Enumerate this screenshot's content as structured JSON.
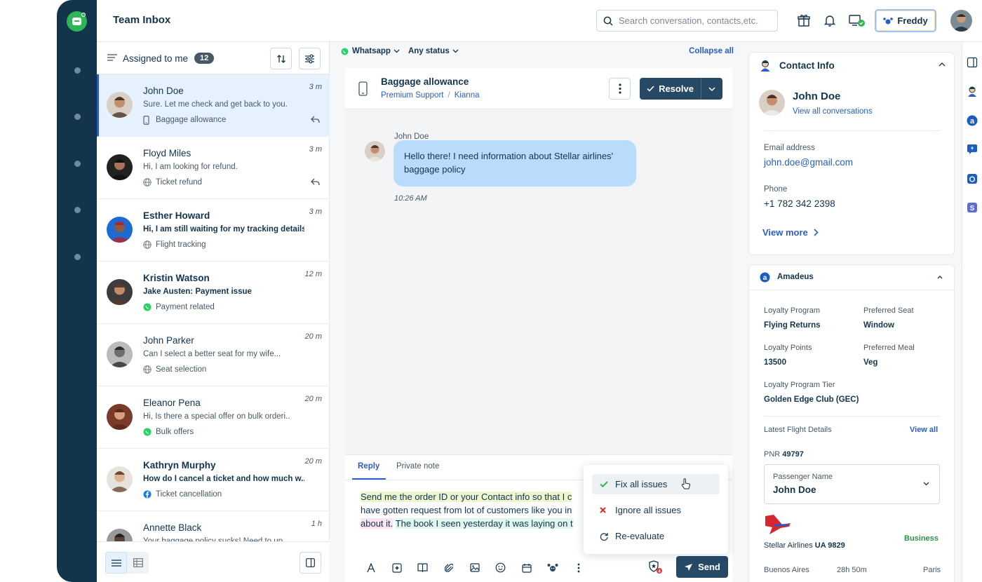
{
  "topbar": {
    "title": "Team Inbox",
    "search_placeholder": "Search conversation, contacts,etc.",
    "freddy_label": "Freddy"
  },
  "list": {
    "filter_label": "Assigned to me",
    "count": "12",
    "conversations": [
      {
        "name": "John Doe",
        "preview": "Sure. Let me check and get back to you.",
        "tag": "Baggage allowance",
        "time": "3 m",
        "channel": "phone-icon",
        "unread": false
      },
      {
        "name": "Floyd Miles",
        "preview": "Hi, I am looking for refund.",
        "tag": "Ticket refund",
        "time": "3 m",
        "channel": "globe-icon",
        "unread": false
      },
      {
        "name": "Esther Howard",
        "preview": "Hi, I am still waiting for my tracking details",
        "tag": "Flight tracking",
        "time": "3 m",
        "channel": "globe-icon",
        "unread": true
      },
      {
        "name": "Kristin Watson",
        "preview": "Jake Austen: Payment issue",
        "tag": "Payment related",
        "time": "12 m",
        "channel": "whatsapp-icon",
        "unread": true
      },
      {
        "name": "John Parker",
        "preview": "Can I select a better seat for my wife...",
        "tag": "Seat selection",
        "time": "20 m",
        "channel": "globe-icon",
        "unread": false
      },
      {
        "name": "Eleanor Pena",
        "preview": "Hi, Is there a special offer on bulk orderi..",
        "tag": "Bulk offers",
        "time": "20 m",
        "channel": "whatsapp-icon",
        "unread": false
      },
      {
        "name": "Kathryn Murphy",
        "preview": "How do I cancel a ticket and how much w...",
        "tag": "Ticket cancellation",
        "time": "20 m",
        "channel": "facebook-icon",
        "unread": true
      },
      {
        "name": "Annette Black",
        "preview": "Your baggage policy sucks! Need to up",
        "tag": "",
        "time": "1 h",
        "channel": "",
        "unread": false
      }
    ]
  },
  "middle": {
    "channel_filter": "Whatsapp",
    "status_filter": "Any status",
    "collapse_all": "Collapse all",
    "subject": "Baggage allowance",
    "group": "Premium Support",
    "agent": "Kianna",
    "resolve_label": "Resolve",
    "message": {
      "sender": "John Doe",
      "text_line1": "Hello there! I need information about Stellar airlines'",
      "text_line2": "baggage policy",
      "time": "10:26 AM"
    },
    "reply": {
      "tab_reply": "Reply",
      "tab_private": "Private note",
      "line1_a": "Send me the order ID or your Contact info so that I c",
      "line2_a": "have gotten request from lot of customers like you in",
      "line3_a": "about it.",
      "line3_b": "The book I seen yesterday it was laying on t",
      "send_label": "Send"
    },
    "popup": {
      "fix": "Fix all issues",
      "ignore": "Ignore all issues",
      "reevaluate": "Re-evaluate"
    }
  },
  "contact": {
    "title": "Contact Info",
    "name": "John Doe",
    "view_all": "View all conversations",
    "email_label": "Email address",
    "email": "john.doe@gmail.com",
    "phone_label": "Phone",
    "phone": "+1 782 342 2398",
    "view_more": "View more"
  },
  "amadeus": {
    "title": "Amadeus",
    "loyalty_program_label": "Loyalty Program",
    "loyalty_program": "Flying Returns",
    "preferred_seat_label": "Preferred Seat",
    "preferred_seat": "Window",
    "loyalty_points_label": "Loyalty Points",
    "loyalty_points": "13500",
    "preferred_meal_label": "Preferred Meal",
    "preferred_meal": "Veg",
    "tier_label": "Loyalty Program Tier",
    "tier": "Golden Edge Club (GEC)",
    "flight_label": "Latest Flight Details",
    "view_all": "View all",
    "pnr_label": "PNR",
    "pnr": "49797",
    "passenger_label": "Passenger Name",
    "passenger": "John Doe",
    "airline": "Stellar Airlines",
    "flight_no": "UA 9829",
    "class": "Business",
    "from": "Buenos Aires",
    "duration": "28h 50m",
    "to": "Paris"
  },
  "colors": {
    "rail": "#12344d",
    "accent": "#2c5cc5",
    "primary_button": "#264966",
    "bubble": "#b9dcfd",
    "whatsapp": "#25d366"
  }
}
